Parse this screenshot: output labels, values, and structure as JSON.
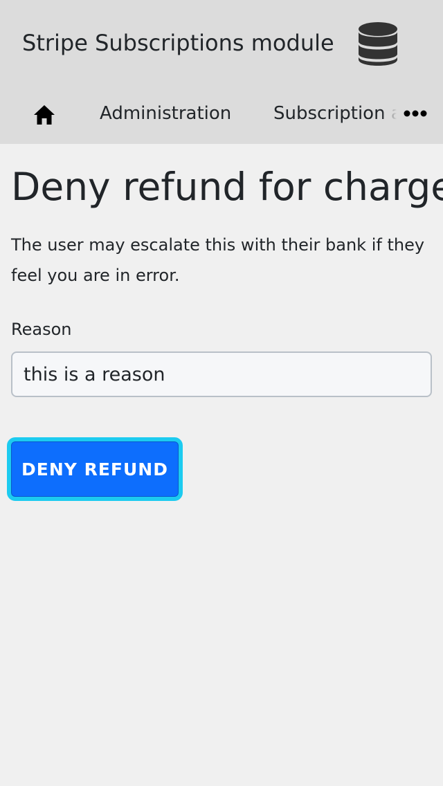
{
  "header": {
    "app_title": "Stripe Subscriptions module",
    "logo_icon": "database-icon"
  },
  "nav": {
    "home_icon": "home-icon",
    "items": [
      {
        "label": "Administration"
      },
      {
        "label": "Subscription and"
      }
    ],
    "more_icon": "more-horizontal-icon"
  },
  "main": {
    "title": "Deny refund for charge",
    "description": "The user may escalate this with their bank if they feel you are in error.",
    "reason_label": "Reason",
    "reason_value": "this is a reason",
    "submit_label": "DENY REFUND"
  },
  "colors": {
    "header_bg": "#dcdcdc",
    "page_bg": "#f0f0f0",
    "primary": "#0d6efd",
    "focus_ring": "#1ccbf0",
    "text": "#212529"
  }
}
